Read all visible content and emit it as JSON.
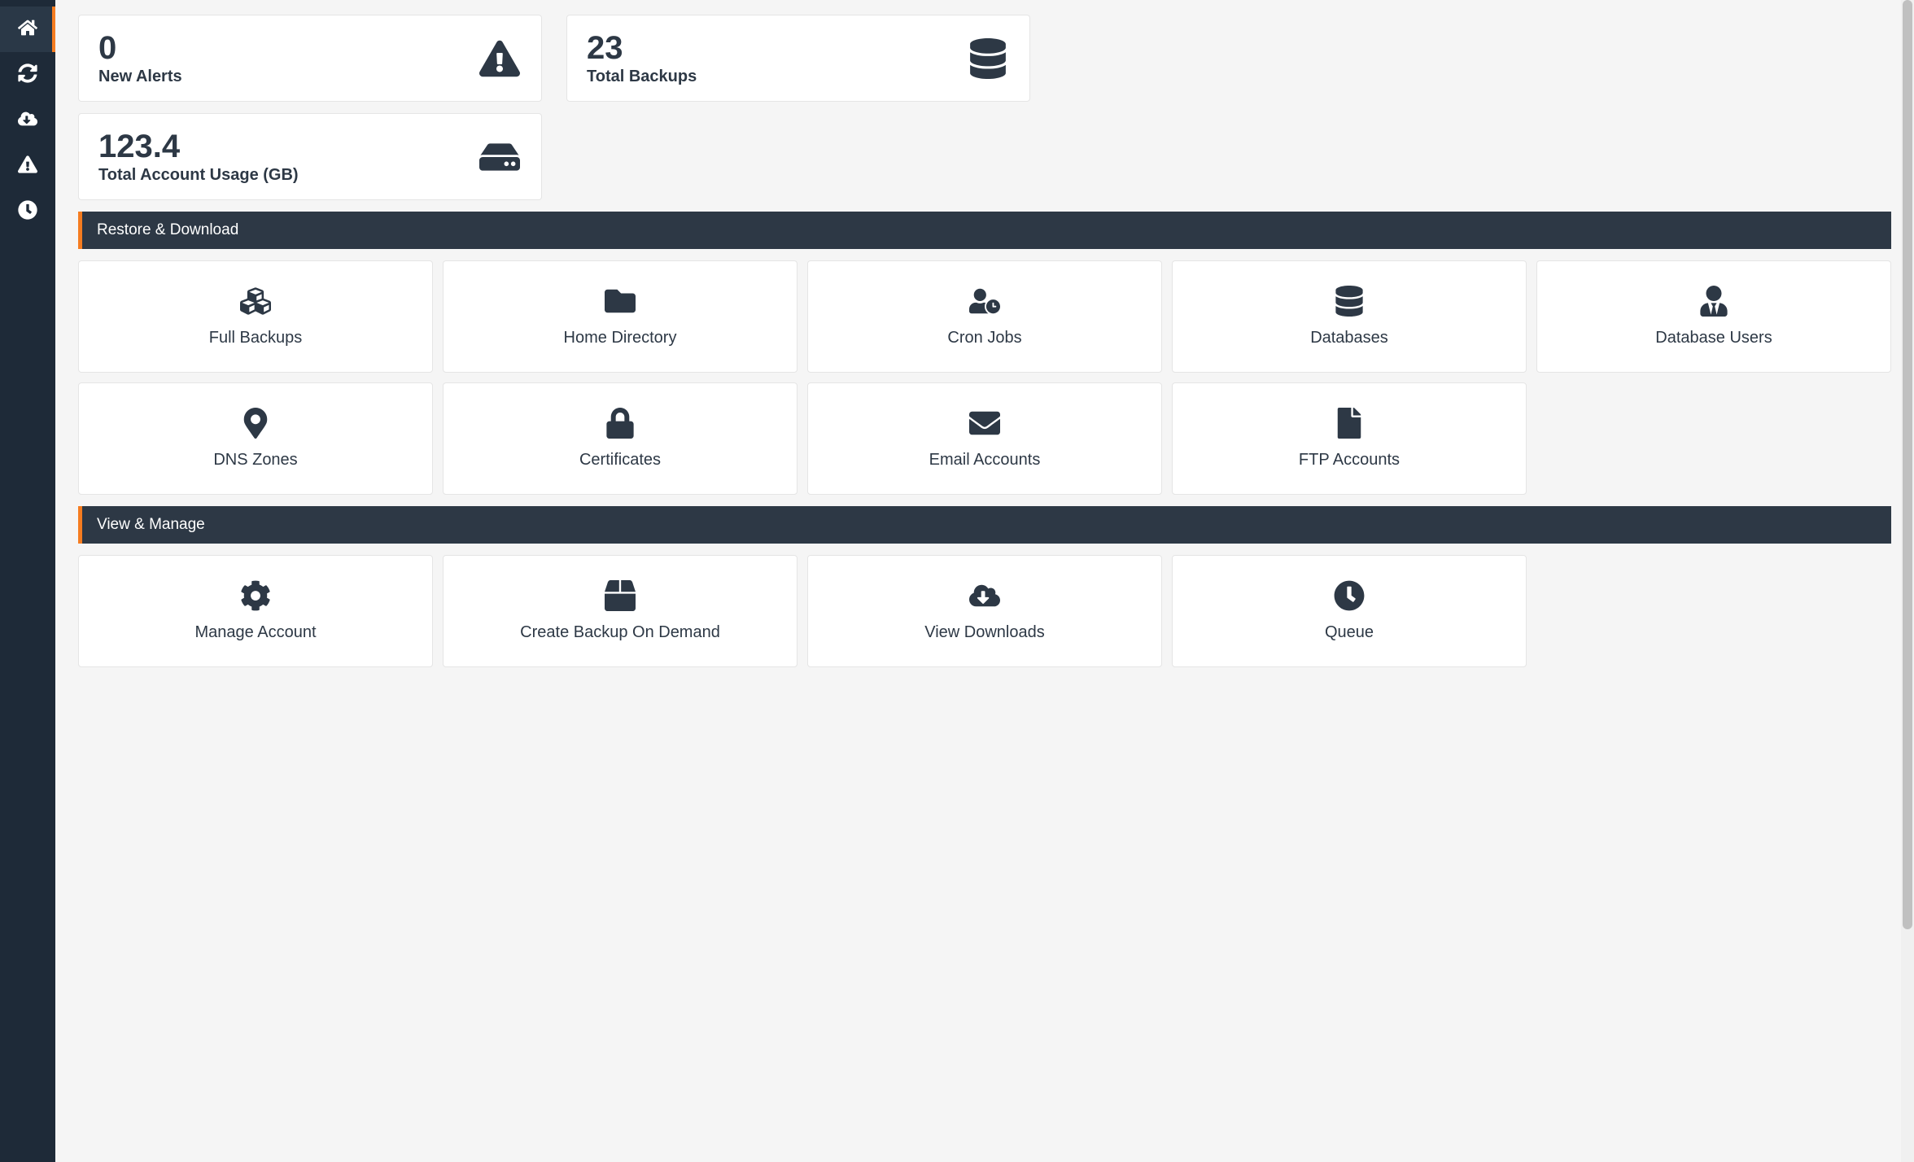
{
  "stats": {
    "alerts": {
      "value": "0",
      "label": "New Alerts"
    },
    "backups": {
      "value": "23",
      "label": "Total Backups"
    },
    "usage": {
      "value": "123.4",
      "label": "Total Account Usage (GB)"
    }
  },
  "sections": {
    "restore": {
      "title": "Restore & Download",
      "tiles": {
        "full_backups": "Full Backups",
        "home_directory": "Home Directory",
        "cron_jobs": "Cron Jobs",
        "databases": "Databases",
        "database_users": "Database Users",
        "dns_zones": "DNS Zones",
        "certificates": "Certificates",
        "email_accounts": "Email Accounts",
        "ftp_accounts": "FTP Accounts"
      }
    },
    "manage": {
      "title": "View & Manage",
      "tiles": {
        "manage_account": "Manage Account",
        "create_backup": "Create Backup On Demand",
        "view_downloads": "View Downloads",
        "queue": "Queue"
      }
    }
  }
}
